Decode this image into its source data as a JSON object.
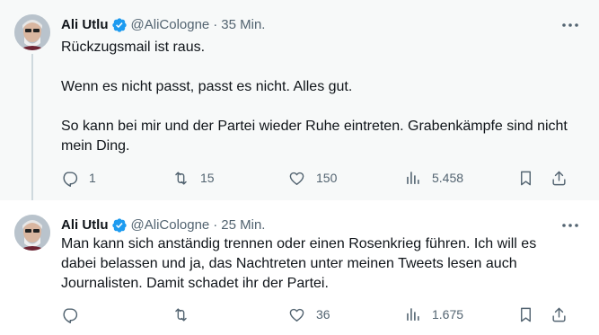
{
  "tweets": [
    {
      "author": {
        "name": "Ali Utlu",
        "handle": "@AliCologne",
        "verified": true
      },
      "time": "35 Min.",
      "paragraphs": [
        "Rückzugsmail ist raus.",
        "Wenn es nicht passt, passt es nicht. Alles gut.",
        "So kann bei mir und der Partei wieder Ruhe eintreten. Grabenkämpfe sind nicht mein Ding."
      ],
      "stats": {
        "replies": "1",
        "retweets": "15",
        "likes": "150",
        "views": "5.458"
      }
    },
    {
      "author": {
        "name": "Ali Utlu",
        "handle": "@AliCologne",
        "verified": true
      },
      "time": "25 Min.",
      "paragraphs": [
        "Man kann sich anständig trennen oder einen Rosenkrieg führen. Ich will es dabei belassen und ja, das Nachtreten unter meinen Tweets lesen auch Journalisten. Damit schadet ihr der Partei."
      ],
      "stats": {
        "replies": "",
        "retweets": "",
        "likes": "36",
        "views": "1.675"
      }
    }
  ],
  "separator": "·",
  "icons": {
    "verified": "verified-badge-icon",
    "more": "more-options-icon",
    "reply": "reply-icon",
    "retweet": "retweet-icon",
    "like": "heart-icon",
    "views": "views-chart-icon",
    "bookmark": "bookmark-icon",
    "share": "share-icon"
  },
  "colors": {
    "text": "#0f1419",
    "secondary": "#536471",
    "verified_blue": "#1d9bf0",
    "highlight_bg": "#f7f9f9",
    "thread_line": "#cfd9de"
  }
}
